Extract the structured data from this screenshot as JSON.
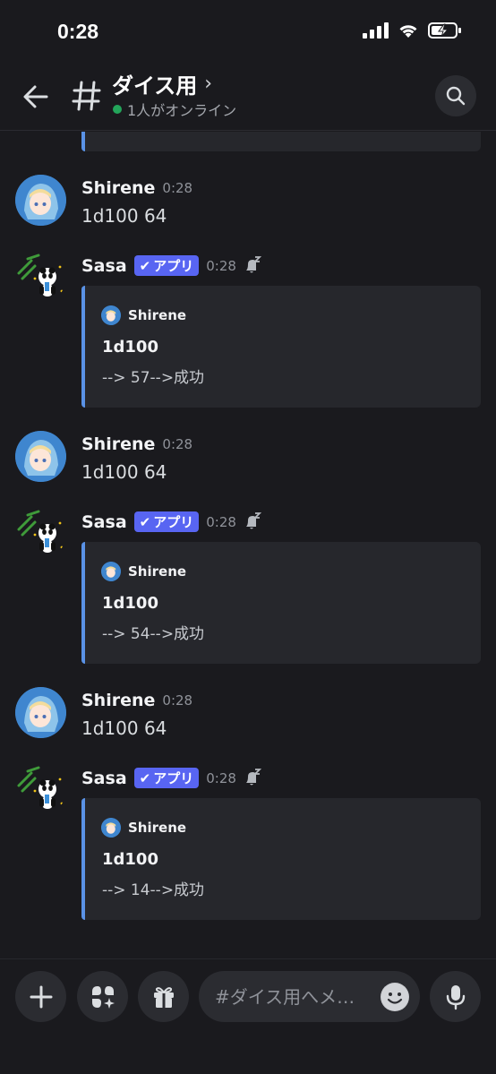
{
  "status_bar": {
    "time": "0:28"
  },
  "header": {
    "channel_name": "ダイス用",
    "chevron": "›",
    "online_text": "1人がオンライン"
  },
  "messages": [
    {
      "type": "user",
      "author": "Shirene",
      "time": "0:28",
      "text": "1d100 64"
    },
    {
      "type": "app",
      "author": "Sasa",
      "badge": "アプリ",
      "time": "0:28",
      "embed": {
        "author": "Shirene",
        "title": "1d100",
        "description": "--> 57-->成功"
      }
    },
    {
      "type": "user",
      "author": "Shirene",
      "time": "0:28",
      "text": "1d100 64"
    },
    {
      "type": "app",
      "author": "Sasa",
      "badge": "アプリ",
      "time": "0:28",
      "embed": {
        "author": "Shirene",
        "title": "1d100",
        "description": "--> 54-->成功"
      }
    },
    {
      "type": "user",
      "author": "Shirene",
      "time": "0:28",
      "text": "1d100 64"
    },
    {
      "type": "app",
      "author": "Sasa",
      "badge": "アプリ",
      "time": "0:28",
      "embed": {
        "author": "Shirene",
        "title": "1d100",
        "description": "--> 14-->成功"
      }
    }
  ],
  "composer": {
    "placeholder": "#ダイス用へメ…"
  },
  "colors": {
    "accent": "#5865f2",
    "online": "#23a55a",
    "embed_bar": "#5a92e6"
  },
  "icons": [
    "back-arrow-icon",
    "hash-icon",
    "search-icon",
    "bell-sleep-icon",
    "plus-icon",
    "apps-icon",
    "gift-icon",
    "emoji-icon",
    "mic-icon"
  ]
}
